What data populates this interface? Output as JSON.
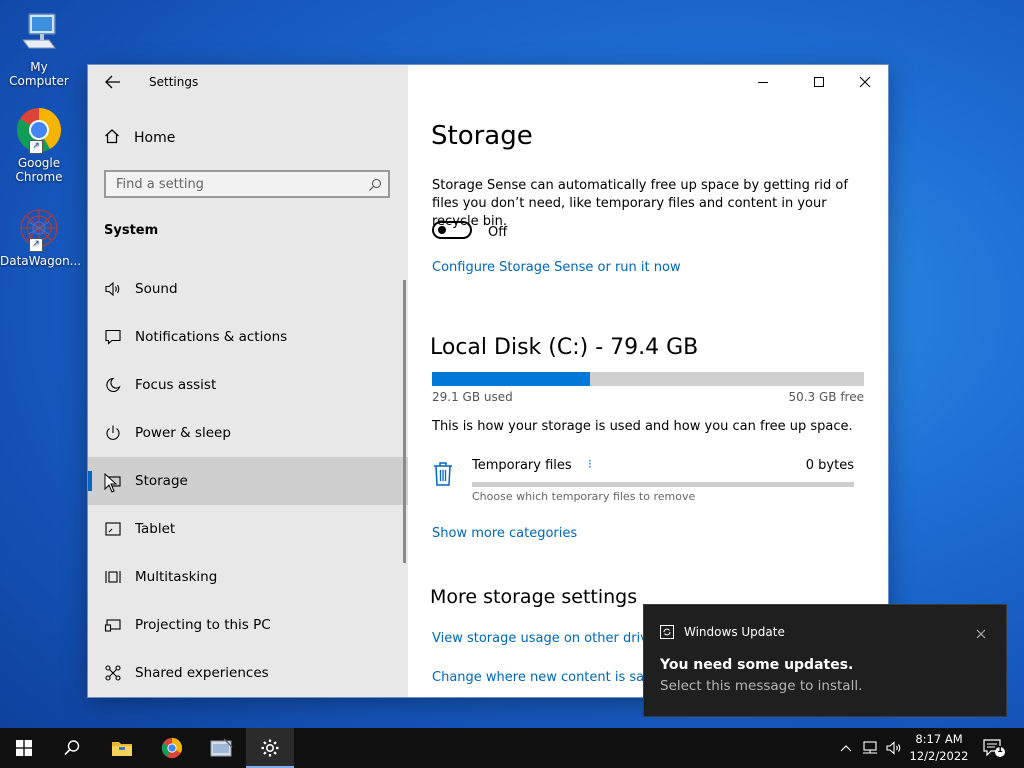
{
  "desktop": {
    "icons": [
      {
        "label": "My Computer"
      },
      {
        "label": "Google Chrome"
      },
      {
        "label": "DataWagon..."
      }
    ]
  },
  "window": {
    "title": "Settings",
    "sidebar": {
      "home_label": "Home",
      "search_placeholder": "Find a setting",
      "section_label": "System",
      "items": [
        {
          "label": "Sound",
          "icon": "speaker-icon"
        },
        {
          "label": "Notifications & actions",
          "icon": "notification-icon"
        },
        {
          "label": "Focus assist",
          "icon": "moon-icon"
        },
        {
          "label": "Power & sleep",
          "icon": "power-icon"
        },
        {
          "label": "Storage",
          "icon": "storage-icon",
          "selected": true
        },
        {
          "label": "Tablet",
          "icon": "tablet-icon"
        },
        {
          "label": "Multitasking",
          "icon": "multitasking-icon"
        },
        {
          "label": "Projecting to this PC",
          "icon": "projecting-icon"
        },
        {
          "label": "Shared experiences",
          "icon": "shared-icon"
        }
      ]
    },
    "main": {
      "title": "Storage",
      "storage_sense_desc": "Storage Sense can automatically free up space by getting rid of files you don’t need, like temporary files and content in your recycle bin.",
      "toggle_state": "Off",
      "configure_link": "Configure Storage Sense or run it now",
      "disk_title": "Local Disk (C:) - 79.4 GB",
      "disk_used": "29.1 GB used",
      "disk_free": "50.3 GB free",
      "disk_used_fraction": 0.366,
      "disk_info": "This is how your storage is used and how you can free up space.",
      "category": {
        "name": "Temporary files",
        "size": "0 bytes",
        "sub": "Choose which temporary files to remove"
      },
      "show_more_link": "Show more categories",
      "more_title": "More storage settings",
      "link_view_usage": "View storage usage on other drives",
      "link_change_location": "Change where new content is saved"
    }
  },
  "toast": {
    "app": "Windows Update",
    "title": "You need some updates.",
    "message": "Select this message to install."
  },
  "taskbar": {
    "time": "8:17 AM",
    "date": "12/2/2022",
    "notification_count": "1"
  },
  "colors": {
    "accent": "#0078d7",
    "link": "#0067b8"
  }
}
